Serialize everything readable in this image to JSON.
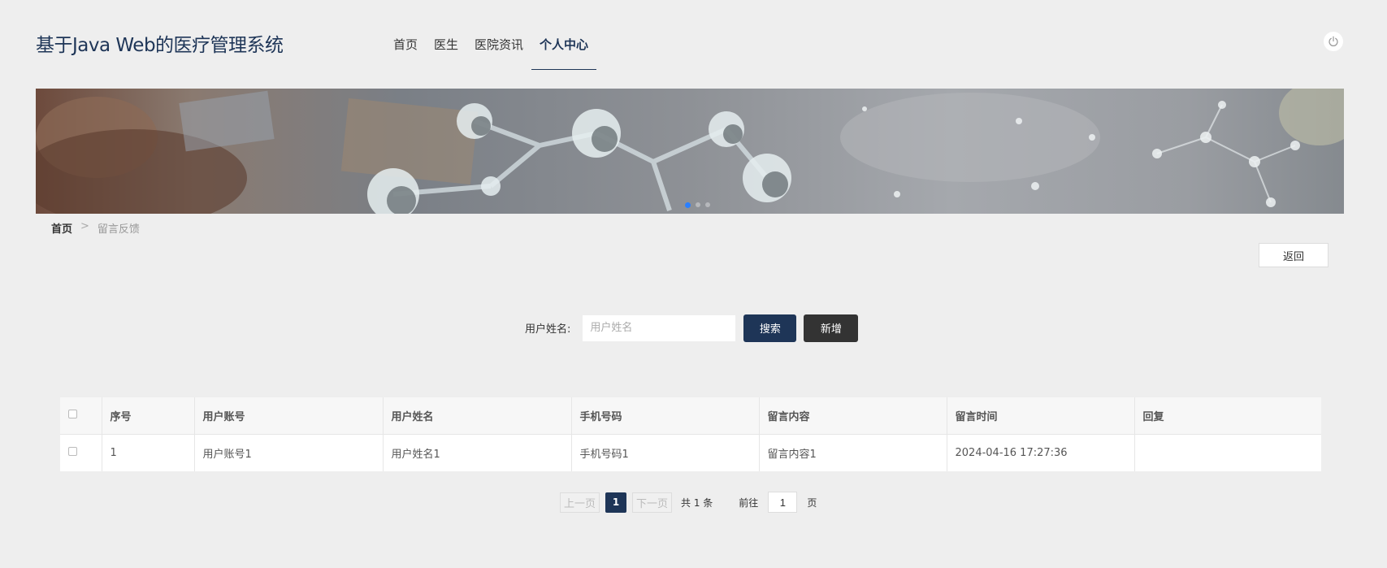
{
  "header": {
    "site_title": "基于Java Web的医疗管理系统",
    "nav": [
      {
        "label": "首页",
        "active": false
      },
      {
        "label": "医生",
        "active": false
      },
      {
        "label": "医院资讯",
        "active": false
      },
      {
        "label": "个人中心",
        "active": true
      }
    ],
    "power_icon": "power-icon"
  },
  "banner": {
    "slides": 3,
    "active_slide": 1
  },
  "breadcrumb": {
    "home": "首页",
    "separator": ">",
    "current": "留言反馈"
  },
  "back_button": "返回",
  "search": {
    "label": "用户姓名:",
    "placeholder": "用户姓名",
    "value": "",
    "search_button": "搜索",
    "add_button": "新增"
  },
  "table": {
    "columns": [
      "序号",
      "用户账号",
      "用户姓名",
      "手机号码",
      "留言内容",
      "留言时间",
      "回复"
    ],
    "rows": [
      {
        "seq": "1",
        "account": "用户账号1",
        "name": "用户姓名1",
        "phone": "手机号码1",
        "content": "留言内容1",
        "time": "2024-04-16 17:27:36",
        "reply": ""
      }
    ]
  },
  "pagination": {
    "prev": "上一页",
    "current_page": "1",
    "next": "下一页",
    "total": "共 1 条",
    "goto_label": "前往",
    "goto_value": "1",
    "page_unit": "页"
  },
  "colors": {
    "primary": "#1e3557",
    "dark_button": "#333333",
    "background": "#eeeeee",
    "active_dot": "#2a7fff"
  }
}
